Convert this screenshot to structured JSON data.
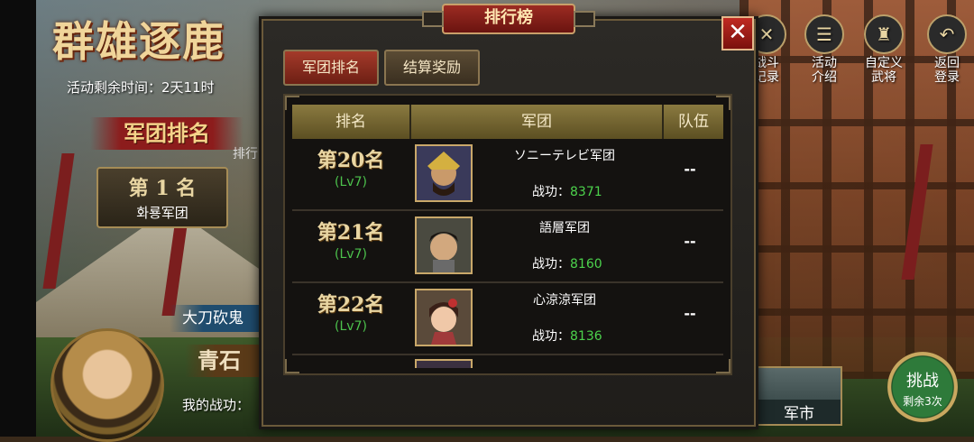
{
  "background": {
    "game_title": "群雄逐鹿",
    "time_left": "活动剩余时间：2天11时",
    "corps_rank_heading": "军团排名",
    "left_rank_tab": "排行",
    "first_place": {
      "rank": "第 1 名",
      "name": "화룡军团"
    },
    "boss_name": "大刀砍鬼",
    "boss_sub": "青石",
    "my_merit": "我的战功：",
    "right_menu": [
      {
        "icon": "close-x-icon",
        "label": "战斗\n记录"
      },
      {
        "icon": "info-scroll-icon",
        "label": "活动\n介绍"
      },
      {
        "icon": "general-icon",
        "label": "自定义\n武将"
      },
      {
        "icon": "return-arrow-icon",
        "label": "返回\n登录"
      }
    ],
    "challenge": {
      "label": "挑战",
      "remaining": "剩余3次"
    },
    "market": {
      "label": "军市"
    }
  },
  "modal": {
    "title": "排行榜",
    "close_label": "✕",
    "tabs": [
      {
        "label": "军团排名",
        "active": true
      },
      {
        "label": "结算奖励",
        "active": false
      }
    ],
    "table": {
      "headers": {
        "rank": "排名",
        "corps": "军团",
        "team": "队伍"
      },
      "merit_label": "战功：",
      "rows": [
        {
          "rank": "第20名",
          "level": "(Lv7)",
          "corps": "ソニーテレビ军团",
          "merit": "8371",
          "team": "--",
          "portrait": "general-gold-helmet-portrait"
        },
        {
          "rank": "第21名",
          "level": "(Lv7)",
          "corps": "語層军团",
          "merit": "8160",
          "team": "--",
          "portrait": "young-warrior-portrait"
        },
        {
          "rank": "第22名",
          "level": "(Lv7)",
          "corps": "心涼涼军团",
          "merit": "8136",
          "team": "--",
          "portrait": "female-general-portrait"
        }
      ]
    }
  },
  "colors": {
    "accent_red": "#9c2b22",
    "gold": "#e9d6a3",
    "merit_green": "#4cd24c",
    "level_green": "#4cc24c"
  }
}
